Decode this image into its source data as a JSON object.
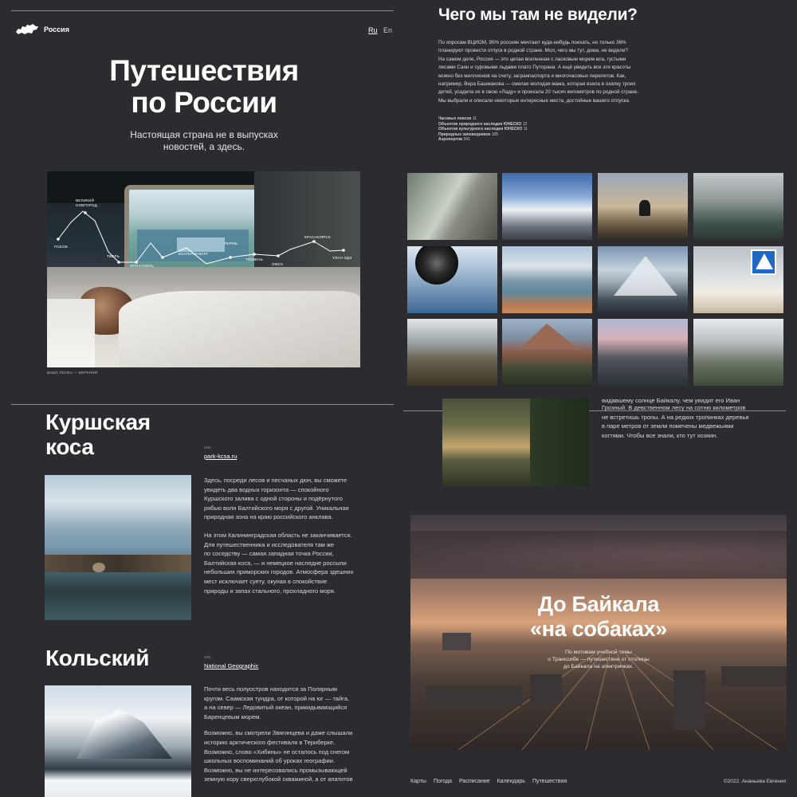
{
  "header": {
    "logo_text": "Россия",
    "lang_ru": "Ru",
    "lang_en": "En"
  },
  "hero": {
    "title_line1": "Путешествия",
    "title_line2": "по России",
    "subtitle_line1": "Настоящая страна не в выпусках",
    "subtitle_line2": "новостей, а здесь.",
    "caption": "ВАША ПОЛКА — ВЕРХНЯЯ"
  },
  "route": {
    "stops": [
      "ПСКОВ",
      "ВЕЛИКИЙ\nНОВГОРОД",
      "ТВЕРЬ",
      "ЯРОСЛАВЛЬ",
      "ЕКАТЕРИНБУРГ",
      "ПЕРМЬ",
      "ТЮМЕНЬ",
      "ОМСК",
      "КРАСНОЯРСК",
      "УЛАН-УДЭ"
    ]
  },
  "intro": {
    "title": "Чего мы там не видели?",
    "paragraph_lines": [
      "По опросам ВЦИОМ, 95% россиян мечтают куда-нибудь поехать, но только 36%",
      "планируют провести отпуск в родной стране. Мол, чего мы тут, дома, не видели?",
      "На самом деле, Россия — это целая вселенная с ласковым морем юга, густыми",
      "лесами Саян и суровыми льдами плато Путорана. А ещё увидеть все эти красоты",
      "можно без миллионов на счету, загранпаспорта и многочасовых перелетов. Как,",
      "например, Вера Башмакова — смелая молодая мама, которая взяла в охапку троих",
      "детей, усадила их в свою «Ладу» и проехала 20 тысяч километров по родной стране.",
      "Мы выбрали и описали некоторые интересные места, достойные вашего отпуска."
    ],
    "stats": [
      {
        "label": "Часовых поясов",
        "value": "11"
      },
      {
        "label": "Объектов природного наследия ЮНЕСКО",
        "value": "12"
      },
      {
        "label": "Объектов культурного наследия ЮНЕСКО",
        "value": "11"
      },
      {
        "label": "Природных заповедников",
        "value": "105"
      },
      {
        "label": "Аэропортов",
        "value": "241"
      }
    ]
  },
  "kursh": {
    "title_line1": "Куршская",
    "title_line2": "коса",
    "url_label": "URL",
    "url": "park-kcsa.ru",
    "p1": [
      "Здесь, посреди лесов и песчаных дюн, вы сможете",
      "увидеть два водных горизонта — спокойного",
      "Куршского залива с одной стороны и подёрнутого",
      "рябью волн Балтийского моря с другой. Уникальная",
      "природная зона на краю российского анклава."
    ],
    "p2": [
      "На этом Калининградская область не заканчивается.",
      "Для путешественника и исследователя там же",
      "по соседству — самая западная точка России,",
      "Балтийская коса, — и немецкое наследие россыпи",
      "небольших приморских городов. Атмосфера здешних",
      "мест исключает суету, окуная в спокойствие",
      "природы и запах стального, прохладного моря."
    ]
  },
  "kola": {
    "title": "Кольский",
    "url_label": "URL",
    "url": "National Geographic",
    "p1": [
      "Почти весь полуостров находится за Полярным",
      "кругом. Саамская тундра, от которой на юг — тайга,",
      "а на север — Ледовитый океан, прикидывающийся",
      "Баренцевым морем."
    ],
    "p2": [
      "Возможно, вы смотрели Звягинцева и даже слышали",
      "историю арктического фестиваля в Териберке.",
      "Возможно, слово «Хибины» не осталось под снегом",
      "школьных воспоминаний об уроках географии.",
      "Возможно, вы не интересовались промызывающей",
      "земную кору сверхглубокой скважиной, а от апатитов"
    ]
  },
  "forest_text": [
    "Грозный. В девственном лесу на сотню километров",
    "не встретишь тропы. А на редких тропинках деревья",
    "в паре метров от земли помечены медвежьими",
    "когтями. Чтобы все знали, кто тут хозяин."
  ],
  "forest_text_cut": "видавшему солнце Байкалу, чем увидит его Иван",
  "baikal": {
    "title_line1": "До Байкала",
    "title_line2": "«на собаках»",
    "sub_line1": "По мотивам учебной темы",
    "sub_line2": "о Транссибе — путешествие от столицы",
    "sub_line3": "до Байкала на электричках."
  },
  "footer": {
    "links": [
      "Карты",
      "Погода",
      "Расписание",
      "Календарь",
      "Путешествия"
    ],
    "copyright": "©2022. Ананьева Евгения"
  },
  "colors": {
    "bg": "#2c2c30",
    "accent": "#ffffff"
  }
}
